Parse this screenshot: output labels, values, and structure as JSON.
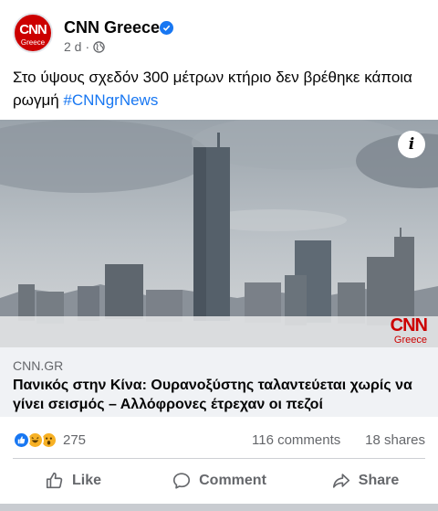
{
  "post": {
    "page_name": "CNN Greece",
    "avatar_logo_top": "CNN",
    "avatar_logo_bottom": "Greece",
    "time": "2 d",
    "dot": "·",
    "text": "Στο ύψους σχεδόν 300 μέτρων κτήριο δεν βρέθηκε κάποια ρωγμή ",
    "hashtag": "#CNNgrNews"
  },
  "link": {
    "info_glyph": "i",
    "watermark_top": "CNN",
    "watermark_bottom": "Greece",
    "domain": "CNN.GR",
    "title": "Πανικός στην Κίνα: Ουρανοξύστης ταλαντεύεται χωρίς να γίνει σεισμός – Αλλόφρονες έτρεχαν οι πεζοί"
  },
  "stats": {
    "reaction_count": "275",
    "comments": "116 comments",
    "shares": "18 shares"
  },
  "actions": {
    "like": "Like",
    "comment": "Comment",
    "share": "Share"
  },
  "icons": [
    "verified-icon",
    "globe-icon",
    "info-icon",
    "like-reaction-icon",
    "haha-reaction-icon",
    "wow-reaction-icon",
    "like-icon",
    "comment-icon",
    "share-icon"
  ],
  "colors": {
    "brand_blue": "#1877f2",
    "cnn_red": "#cc0000",
    "secondary_text": "#65676b",
    "caption_bg": "#f0f2f5"
  }
}
